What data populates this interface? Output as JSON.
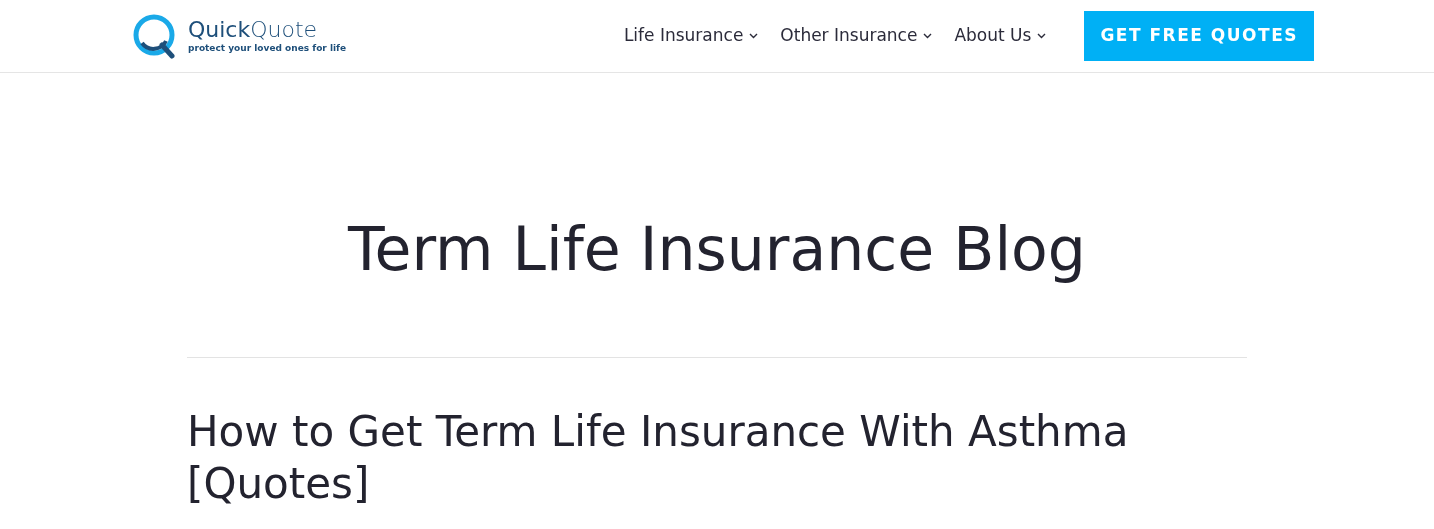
{
  "logo": {
    "name": "**Quick**Quote",
    "tagline": "protect your loved ones for life"
  },
  "nav": [
    {
      "label": "Life Insurance",
      "has_menu": true
    },
    {
      "label": "Other Insurance",
      "has_menu": true
    },
    {
      "label": "About Us",
      "has_menu": true
    }
  ],
  "cta": "GET FREE QUOTES",
  "page_title": "Term Life Insurance Blog",
  "posts": [
    {
      "title": "How to Get Term Life Insurance With Asthma [Quotes]"
    }
  ]
}
